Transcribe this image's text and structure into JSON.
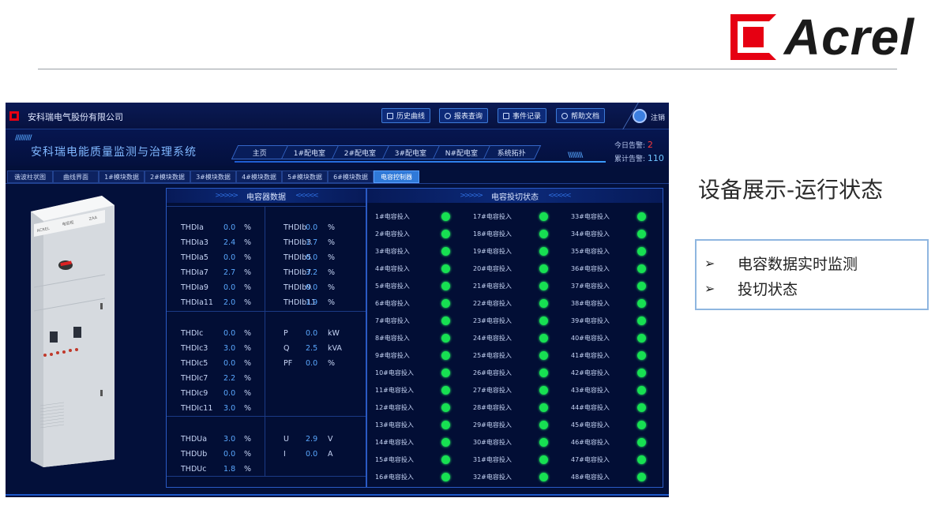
{
  "slide": {
    "brand": "Acrel",
    "section_title": "设备展示-运行状态",
    "bullets": [
      "电容数据实时监测",
      "投切状态"
    ],
    "bullet_marker": "➢"
  },
  "app": {
    "company": "安科瑞电气股份有限公司",
    "toolbar": [
      {
        "label": "历史曲线",
        "icon": "chart-icon"
      },
      {
        "label": "报表查询",
        "icon": "search-icon"
      },
      {
        "label": "事件记录",
        "icon": "document-icon"
      },
      {
        "label": "帮助文档",
        "icon": "help-icon"
      }
    ],
    "logout": "注销",
    "system_title": "安科瑞电能质量监测与治理系统",
    "nav": [
      "主页",
      "1#配电室",
      "2#配电室",
      "3#配电室",
      "N#配电室",
      "系统拓扑"
    ],
    "alarm": {
      "today_label": "今日告警:",
      "today_value": "2",
      "total_label": "累计告警:",
      "total_value": "110"
    },
    "subtabs": [
      "谐波柱状图",
      "曲线界面",
      "1#模块数据",
      "2#模块数据",
      "3#模块数据",
      "4#模块数据",
      "5#模块数据",
      "6#模块数据",
      "电容控制器"
    ],
    "active_subtab": "电容控制器",
    "cabinet_labels": {
      "left": "ACREL",
      "mid": "电容柜",
      "right": "ZAA"
    },
    "capacitor_panel": {
      "title": "电容器数据",
      "group_a": [
        [
          "THDIa",
          "0.0",
          "%",
          "THDIb",
          "0.0",
          "%"
        ],
        [
          "THDIa3",
          "2.4",
          "%",
          "THDIb3",
          "1.7",
          "%"
        ],
        [
          "THDIa5",
          "0.0",
          "%",
          "THDIb5",
          "0.0",
          "%"
        ],
        [
          "THDIa7",
          "2.7",
          "%",
          "THDIb7",
          "3.2",
          "%"
        ],
        [
          "THDIa9",
          "0.0",
          "%",
          "THDIb9",
          "0.0",
          "%"
        ],
        [
          "THDIa11",
          "2.0",
          "%",
          "THDIb11",
          "1.9",
          "%"
        ]
      ],
      "group_c": [
        [
          "THDIc",
          "0.0",
          "%",
          "P",
          "0.0",
          "kW"
        ],
        [
          "THDIc3",
          "3.0",
          "%",
          "Q",
          "2.5",
          "kVA"
        ],
        [
          "THDIc5",
          "0.0",
          "%",
          "PF",
          "0.0",
          "%"
        ],
        [
          "THDIc7",
          "2.2",
          "%",
          "",
          "",
          ""
        ],
        [
          "THDIc9",
          "0.0",
          "%",
          "",
          "",
          ""
        ],
        [
          "THDIc11",
          "3.0",
          "%",
          "",
          "",
          ""
        ]
      ],
      "group_u": [
        [
          "THDUa",
          "3.0",
          "%",
          "U",
          "2.9",
          "V"
        ],
        [
          "THDUb",
          "0.0",
          "%",
          "I",
          "0.0",
          "A"
        ],
        [
          "THDUc",
          "1.8",
          "%",
          "",
          "",
          ""
        ]
      ]
    },
    "switch_panel": {
      "title": "电容投切状态",
      "items": [
        "1#电容投入",
        "2#电容投入",
        "3#电容投入",
        "4#电容投入",
        "5#电容投入",
        "6#电容投入",
        "7#电容投入",
        "8#电容投入",
        "9#电容投入",
        "10#电容投入",
        "11#电容投入",
        "12#电容投入",
        "13#电容投入",
        "14#电容投入",
        "15#电容投入",
        "16#电容投入",
        "17#电容投入",
        "18#电容投入",
        "19#电容投入",
        "20#电容投入",
        "21#电容投入",
        "22#电容投入",
        "23#电容投入",
        "24#电容投入",
        "25#电容投入",
        "26#电容投入",
        "27#电容投入",
        "28#电容投入",
        "29#电容投入",
        "30#电容投入",
        "31#电容投入",
        "32#电容投入",
        "33#电容投入",
        "34#电容投入",
        "35#电容投入",
        "36#电容投入",
        "37#电容投入",
        "38#电容投入",
        "39#电容投入",
        "40#电容投入",
        "41#电容投入",
        "42#电容投入",
        "43#电容投入",
        "44#电容投入",
        "45#电容投入",
        "46#电容投入",
        "47#电容投入",
        "48#电容投入"
      ],
      "status_color": "#17e052"
    }
  },
  "colors": {
    "brand_red": "#e60012",
    "app_bg": "#03103a",
    "accent_blue": "#2f79d8"
  }
}
